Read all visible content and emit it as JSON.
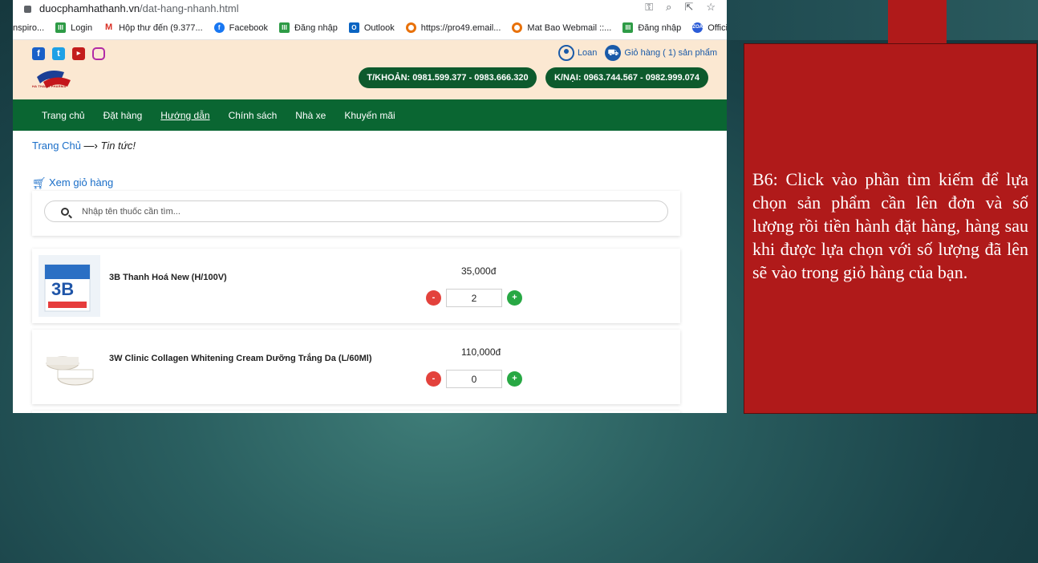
{
  "browser": {
    "domain": "duocphamhathanh.vn",
    "path": "/dat-hang-nhanh.html"
  },
  "bookmarks": [
    {
      "label": "nspiro...",
      "icon": "none"
    },
    {
      "label": "Login",
      "icon": "bars-icon"
    },
    {
      "label": "Hộp thư đến (9.377...",
      "icon": "gmail-icon"
    },
    {
      "label": "Facebook",
      "icon": "facebook-icon"
    },
    {
      "label": "Đăng nhập",
      "icon": "bars-icon"
    },
    {
      "label": "Outlook",
      "icon": "outlook-icon"
    },
    {
      "label": "https://pro49.email...",
      "icon": "ring-icon"
    },
    {
      "label": "Mat Bao Webmail ::...",
      "icon": "ring-icon"
    },
    {
      "label": "Đăng nhập",
      "icon": "bars-icon"
    },
    {
      "label": "Official Acc",
      "icon": "zoa-icon"
    }
  ],
  "header": {
    "user_name": "Loan",
    "cart_label": "Giỏ hàng ( 1) sản phẩm",
    "account_pill": "T/KHOẢN: 0981.599.377 - 0983.666.320",
    "phone_pill": "K/NẠI: 0963.744.567 - 0982.999.074",
    "logo_text": "HA THANH PHARMA"
  },
  "nav": {
    "items": [
      "Trang chủ",
      "Đặt hàng",
      "Hướng dẫn",
      "Chính sách",
      "Nhà xe",
      "Khuyến mãi"
    ],
    "active": "Hướng dẫn"
  },
  "breadcrumb": {
    "home": "Trang Chủ",
    "separator": " —› ",
    "current": "Tin tức!"
  },
  "view_cart_label": "Xem giỏ hàng",
  "search": {
    "placeholder": "Nhập tên thuốc cần tìm..."
  },
  "products": [
    {
      "name": "3B Thanh Hoá New (H/100V)",
      "price": "35,000đ",
      "qty": "2"
    },
    {
      "name": "3W Clinic Collagen Whitening Cream Dưỡng Trắng Da (L/60Ml)",
      "price": "110,000đ",
      "qty": "0"
    }
  ],
  "instruction": "B6: Click vào phần tìm kiếm để lựa chọn sản phẩm cần lên đơn và số lượng rồi tiền hành đặt hàng, hàng sau khi được lựa chọn với số lượng đã lên sẽ vào trong giỏ hàng của bạn.",
  "colors": {
    "header_bg": "#fbe8d2",
    "nav_green": "#0a6632",
    "pill_green": "#0d5a2d",
    "callout_red": "#b01a1a",
    "link_blue": "#1a6ec8"
  }
}
